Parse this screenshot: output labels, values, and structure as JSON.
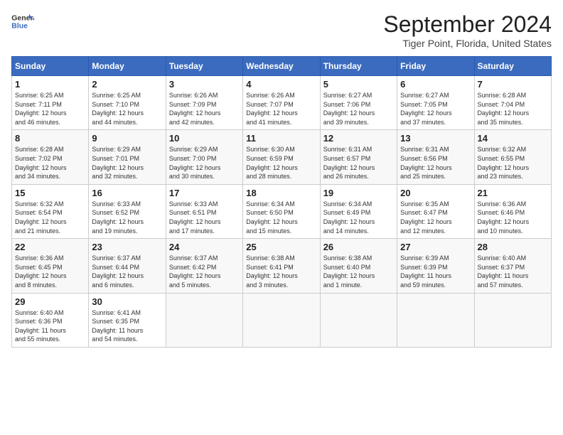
{
  "header": {
    "logo_line1": "General",
    "logo_line2": "Blue",
    "month": "September 2024",
    "location": "Tiger Point, Florida, United States"
  },
  "weekdays": [
    "Sunday",
    "Monday",
    "Tuesday",
    "Wednesday",
    "Thursday",
    "Friday",
    "Saturday"
  ],
  "weeks": [
    [
      {
        "day": "1",
        "info": "Sunrise: 6:25 AM\nSunset: 7:11 PM\nDaylight: 12 hours\nand 46 minutes."
      },
      {
        "day": "2",
        "info": "Sunrise: 6:25 AM\nSunset: 7:10 PM\nDaylight: 12 hours\nand 44 minutes."
      },
      {
        "day": "3",
        "info": "Sunrise: 6:26 AM\nSunset: 7:09 PM\nDaylight: 12 hours\nand 42 minutes."
      },
      {
        "day": "4",
        "info": "Sunrise: 6:26 AM\nSunset: 7:07 PM\nDaylight: 12 hours\nand 41 minutes."
      },
      {
        "day": "5",
        "info": "Sunrise: 6:27 AM\nSunset: 7:06 PM\nDaylight: 12 hours\nand 39 minutes."
      },
      {
        "day": "6",
        "info": "Sunrise: 6:27 AM\nSunset: 7:05 PM\nDaylight: 12 hours\nand 37 minutes."
      },
      {
        "day": "7",
        "info": "Sunrise: 6:28 AM\nSunset: 7:04 PM\nDaylight: 12 hours\nand 35 minutes."
      }
    ],
    [
      {
        "day": "8",
        "info": "Sunrise: 6:28 AM\nSunset: 7:02 PM\nDaylight: 12 hours\nand 34 minutes."
      },
      {
        "day": "9",
        "info": "Sunrise: 6:29 AM\nSunset: 7:01 PM\nDaylight: 12 hours\nand 32 minutes."
      },
      {
        "day": "10",
        "info": "Sunrise: 6:29 AM\nSunset: 7:00 PM\nDaylight: 12 hours\nand 30 minutes."
      },
      {
        "day": "11",
        "info": "Sunrise: 6:30 AM\nSunset: 6:59 PM\nDaylight: 12 hours\nand 28 minutes."
      },
      {
        "day": "12",
        "info": "Sunrise: 6:31 AM\nSunset: 6:57 PM\nDaylight: 12 hours\nand 26 minutes."
      },
      {
        "day": "13",
        "info": "Sunrise: 6:31 AM\nSunset: 6:56 PM\nDaylight: 12 hours\nand 25 minutes."
      },
      {
        "day": "14",
        "info": "Sunrise: 6:32 AM\nSunset: 6:55 PM\nDaylight: 12 hours\nand 23 minutes."
      }
    ],
    [
      {
        "day": "15",
        "info": "Sunrise: 6:32 AM\nSunset: 6:54 PM\nDaylight: 12 hours\nand 21 minutes."
      },
      {
        "day": "16",
        "info": "Sunrise: 6:33 AM\nSunset: 6:52 PM\nDaylight: 12 hours\nand 19 minutes."
      },
      {
        "day": "17",
        "info": "Sunrise: 6:33 AM\nSunset: 6:51 PM\nDaylight: 12 hours\nand 17 minutes."
      },
      {
        "day": "18",
        "info": "Sunrise: 6:34 AM\nSunset: 6:50 PM\nDaylight: 12 hours\nand 15 minutes."
      },
      {
        "day": "19",
        "info": "Sunrise: 6:34 AM\nSunset: 6:49 PM\nDaylight: 12 hours\nand 14 minutes."
      },
      {
        "day": "20",
        "info": "Sunrise: 6:35 AM\nSunset: 6:47 PM\nDaylight: 12 hours\nand 12 minutes."
      },
      {
        "day": "21",
        "info": "Sunrise: 6:36 AM\nSunset: 6:46 PM\nDaylight: 12 hours\nand 10 minutes."
      }
    ],
    [
      {
        "day": "22",
        "info": "Sunrise: 6:36 AM\nSunset: 6:45 PM\nDaylight: 12 hours\nand 8 minutes."
      },
      {
        "day": "23",
        "info": "Sunrise: 6:37 AM\nSunset: 6:44 PM\nDaylight: 12 hours\nand 6 minutes."
      },
      {
        "day": "24",
        "info": "Sunrise: 6:37 AM\nSunset: 6:42 PM\nDaylight: 12 hours\nand 5 minutes."
      },
      {
        "day": "25",
        "info": "Sunrise: 6:38 AM\nSunset: 6:41 PM\nDaylight: 12 hours\nand 3 minutes."
      },
      {
        "day": "26",
        "info": "Sunrise: 6:38 AM\nSunset: 6:40 PM\nDaylight: 12 hours\nand 1 minute."
      },
      {
        "day": "27",
        "info": "Sunrise: 6:39 AM\nSunset: 6:39 PM\nDaylight: 11 hours\nand 59 minutes."
      },
      {
        "day": "28",
        "info": "Sunrise: 6:40 AM\nSunset: 6:37 PM\nDaylight: 11 hours\nand 57 minutes."
      }
    ],
    [
      {
        "day": "29",
        "info": "Sunrise: 6:40 AM\nSunset: 6:36 PM\nDaylight: 11 hours\nand 55 minutes."
      },
      {
        "day": "30",
        "info": "Sunrise: 6:41 AM\nSunset: 6:35 PM\nDaylight: 11 hours\nand 54 minutes."
      },
      null,
      null,
      null,
      null,
      null
    ]
  ]
}
